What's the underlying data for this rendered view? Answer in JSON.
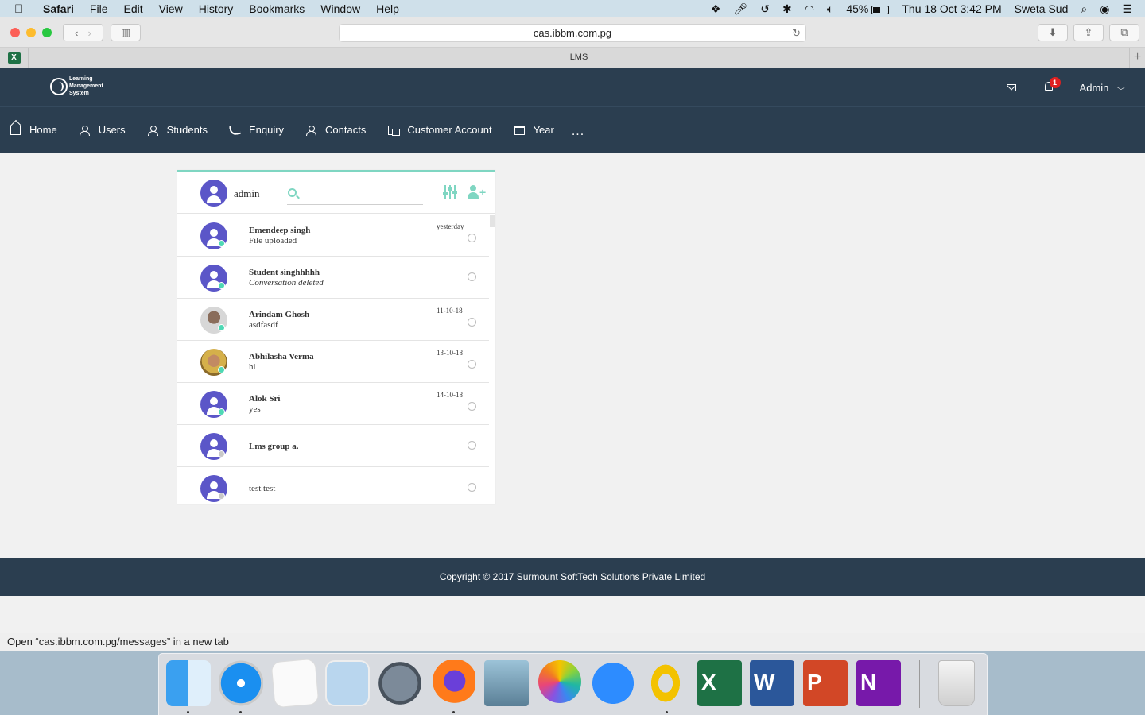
{
  "menubar": {
    "app": "Safari",
    "items": [
      "File",
      "Edit",
      "View",
      "History",
      "Bookmarks",
      "Window",
      "Help"
    ],
    "battery": "45%",
    "datetime": "Thu 18 Oct  3:42 PM",
    "user": "Sweta Sud"
  },
  "browser": {
    "url": "cas.ibbm.com.pg",
    "tab_title": "LMS",
    "status_text": "Open “cas.ibbm.com.pg/messages” in a new tab"
  },
  "site": {
    "logo": {
      "line1": "Learning",
      "line2": "Management",
      "line3": "System"
    },
    "notifications_count": "1",
    "user_menu": "Admin",
    "nav": [
      {
        "label": "Home"
      },
      {
        "label": "Users"
      },
      {
        "label": "Students"
      },
      {
        "label": "Enquiry"
      },
      {
        "label": "Contacts"
      },
      {
        "label": "Customer Account"
      },
      {
        "label": "Year"
      }
    ],
    "nav_more": "...",
    "footer": "Copyright © 2017 Surmount SoftTech Solutions Private Limited"
  },
  "messages": {
    "current_user": "admin",
    "search_placeholder": "",
    "conversations": [
      {
        "name": "Emendeep singh",
        "last": "File uploaded",
        "date": "yesterday",
        "status": "online"
      },
      {
        "name": "Student singhhhhh",
        "last": "Conversation deleted",
        "date": "",
        "status": "online"
      },
      {
        "name": "Arindam Ghosh",
        "last": "asdfasdf",
        "date": "11-10-18",
        "status": "online"
      },
      {
        "name": "Abhilasha Verma",
        "last": "hi",
        "date": "13-10-18",
        "status": "online"
      },
      {
        "name": "Alok Sri",
        "last": "yes",
        "date": "14-10-18",
        "status": "online"
      },
      {
        "name": "Lms group a.",
        "last": "",
        "date": "",
        "status": "offline"
      },
      {
        "name": "test test",
        "last": "",
        "date": "",
        "status": "offline"
      }
    ]
  },
  "colors": {
    "header_bg": "#2b3e50",
    "accent": "#7fd6c2",
    "avatar": "#5b56c8",
    "online": "#4ed8b4",
    "offline": "#c8c8c8",
    "badge": "#e02020"
  },
  "dock": {
    "apps": [
      "finder-icon",
      "safari-icon",
      "reminders-icon",
      "preview-icon",
      "launchpad-icon",
      "firefox-icon",
      "remote-desktop-icon",
      "photos-icon",
      "zoom-icon",
      "outlook-icon",
      "excel-icon",
      "word-icon",
      "powerpoint-icon",
      "onenote-icon",
      "trash-icon"
    ]
  }
}
